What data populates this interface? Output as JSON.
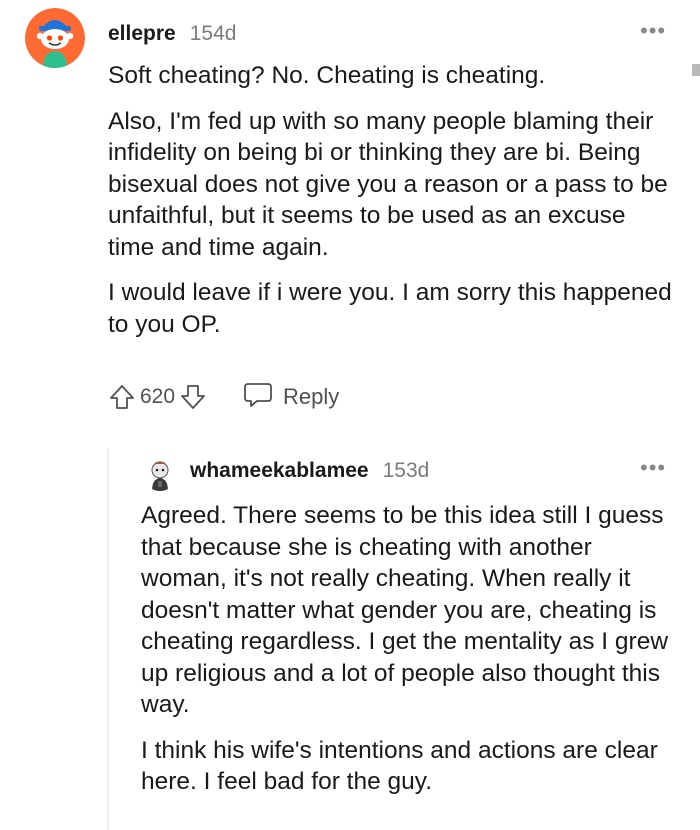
{
  "comments": [
    {
      "username": "ellepre",
      "age": "154d",
      "more": "•••",
      "paragraphs": [
        "Soft cheating? No. Cheating is cheating.",
        "Also, I'm fed up with so many people blaming their infidelity on being bi or thinking they are bi. Being bisexual does not give you a reason or a pass to be unfaithful, but it seems to be used as an excuse time and time again.",
        "I would leave if i were you. I am sorry this happened to you OP."
      ],
      "score": "620",
      "reply_label": "Reply",
      "avatar_icon": "snoo-avatar-icon"
    },
    {
      "username": "whameekablamee",
      "age": "153d",
      "more": "•••",
      "paragraphs": [
        "Agreed. There seems to be this idea still I guess that because she is cheating with another woman, it's not really cheating. When really it doesn't matter what gender you are, cheating is cheating regardless. I get the mentality as I grew up religious and a lot of people also thought this way.",
        "I think his wife's intentions and actions are clear here. I feel bad for the guy."
      ],
      "avatar_icon": "snoo-avatar-icon"
    }
  ],
  "colors": {
    "text": "#1a1a1b",
    "muted": "#787c7e",
    "action": "#4f5154",
    "thread_line": "#edeff1"
  }
}
